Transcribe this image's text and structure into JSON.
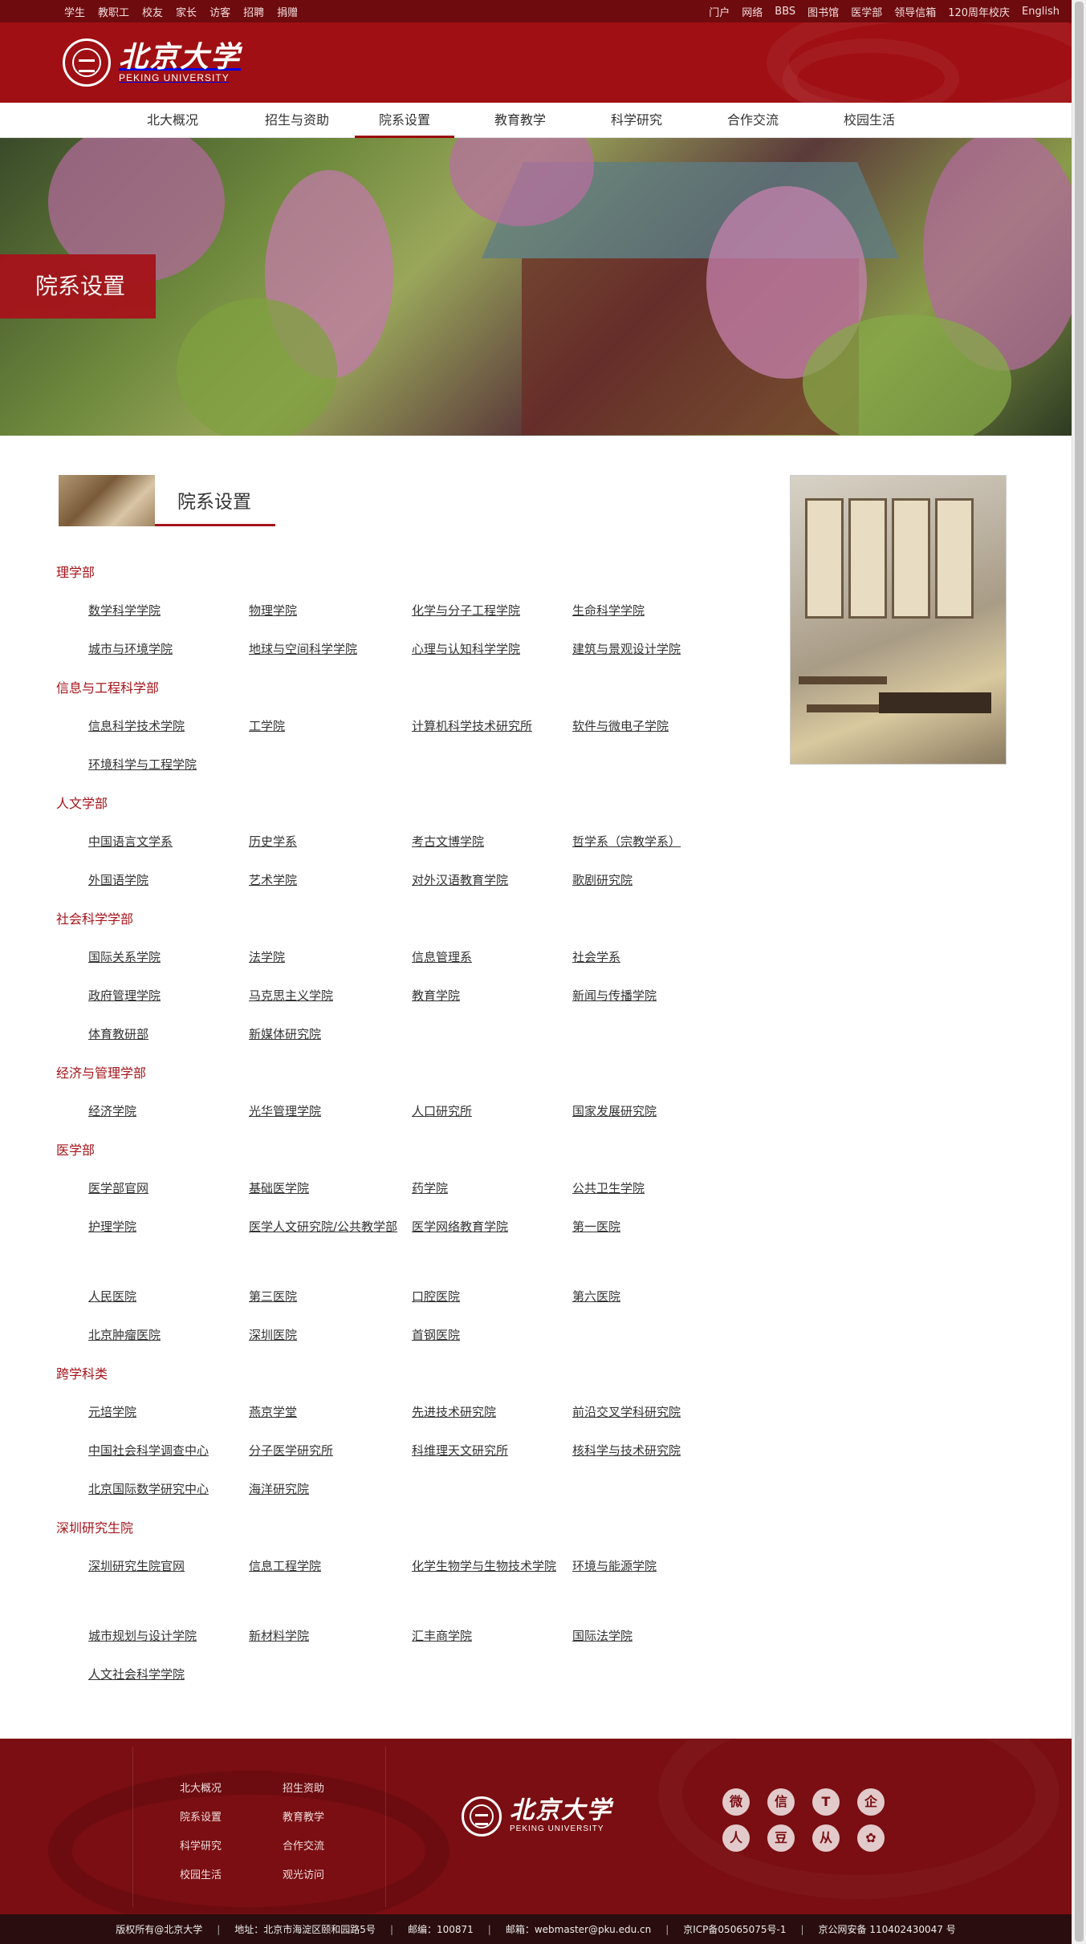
{
  "top_links_left": [
    "学生",
    "教职工",
    "校友",
    "家长",
    "访客",
    "招聘",
    "捐赠"
  ],
  "top_links_right": [
    "门户",
    "网络",
    "BBS",
    "图书馆",
    "医学部",
    "领导信箱",
    "120周年校庆",
    "English"
  ],
  "logo": {
    "cn": "北京大学",
    "en": "PEKING UNIVERSITY"
  },
  "nav": [
    "北大概况",
    "招生与资助",
    "院系设置",
    "教育教学",
    "科学研究",
    "合作交流",
    "校园生活"
  ],
  "nav_active": "院系设置",
  "banner_title": "院系设置",
  "section_title": "院系设置",
  "categories": [
    {
      "name": "理学部",
      "items": [
        "数学科学学院",
        "物理学院",
        "化学与分子工程学院",
        "生命科学学院",
        "城市与环境学院",
        "地球与空间科学学院",
        "心理与认知科学学院",
        "建筑与景观设计学院"
      ]
    },
    {
      "name": "信息与工程科学部",
      "items": [
        "信息科学技术学院",
        "工学院",
        "计算机科学技术研究所",
        "软件与微电子学院",
        "环境科学与工程学院"
      ]
    },
    {
      "name": "人文学部",
      "items": [
        "中国语言文学系",
        "历史学系",
        "考古文博学院",
        "哲学系（宗教学系）",
        "外国语学院",
        "艺术学院",
        "对外汉语教育学院",
        "歌剧研究院"
      ]
    },
    {
      "name": "社会科学学部",
      "items": [
        "国际关系学院",
        "法学院",
        "信息管理系",
        "社会学系",
        "政府管理学院",
        "马克思主义学院",
        "教育学院",
        "新闻与传播学院",
        "体育教研部",
        "新媒体研究院"
      ]
    },
    {
      "name": "经济与管理学部",
      "items": [
        "经济学院",
        "光华管理学院",
        "人口研究所",
        "国家发展研究院"
      ]
    },
    {
      "name": "医学部",
      "items": [
        "医学部官网",
        "基础医学院",
        "药学院",
        "公共卫生学院",
        "护理学院",
        "医学人文研究院/公共教学部",
        "医学网络教育学院",
        "第一医院",
        "人民医院",
        "第三医院",
        "口腔医院",
        "第六医院",
        "北京肿瘤医院",
        "深圳医院",
        "首钢医院"
      ]
    },
    {
      "name": "跨学科类",
      "items": [
        "元培学院",
        "燕京学堂",
        "先进技术研究院",
        "前沿交叉学科研究院",
        "中国社会科学调查中心",
        "分子医学研究所",
        "科维理天文研究所",
        "核科学与技术研究院",
        "北京国际数学研究中心",
        "海洋研究院"
      ]
    },
    {
      "name": "深圳研究生院",
      "items": [
        "深圳研究生院官网",
        "信息工程学院",
        "化学生物学与生物技术学院",
        "环境与能源学院",
        "城市规划与设计学院",
        "新材料学院",
        "汇丰商学院",
        "国际法学院",
        "人文社会科学学院"
      ]
    }
  ],
  "footer_links": [
    [
      "北大概况",
      "招生资助"
    ],
    [
      "院系设置",
      "教育教学"
    ],
    [
      "科学研究",
      "合作交流"
    ],
    [
      "校园生活",
      "观光访问"
    ]
  ],
  "footer_logo": {
    "cn": "北京大学",
    "en": "PEKING UNIVERSITY"
  },
  "social_icons": [
    "weibo-icon",
    "wechat-icon",
    "tencent-weibo-icon",
    "qq-icon",
    "renren-icon",
    "douban-icon",
    "people-icon",
    "clover-icon"
  ],
  "social_glyphs": [
    "微",
    "信",
    "T",
    "企",
    "人",
    "豆",
    "从",
    "✿"
  ],
  "bottom": [
    "版权所有@北京大学",
    "地址：北京市海淀区颐和园路5号",
    "邮编：100871",
    "邮箱：webmaster@pku.edu.cn",
    "京ICP备05065075号-1",
    "京公网安备 110402430047 号"
  ],
  "colors": {
    "brand_red": "#a00f13",
    "dark_red": "#6e0b0e",
    "category_red": "#a6131a"
  }
}
